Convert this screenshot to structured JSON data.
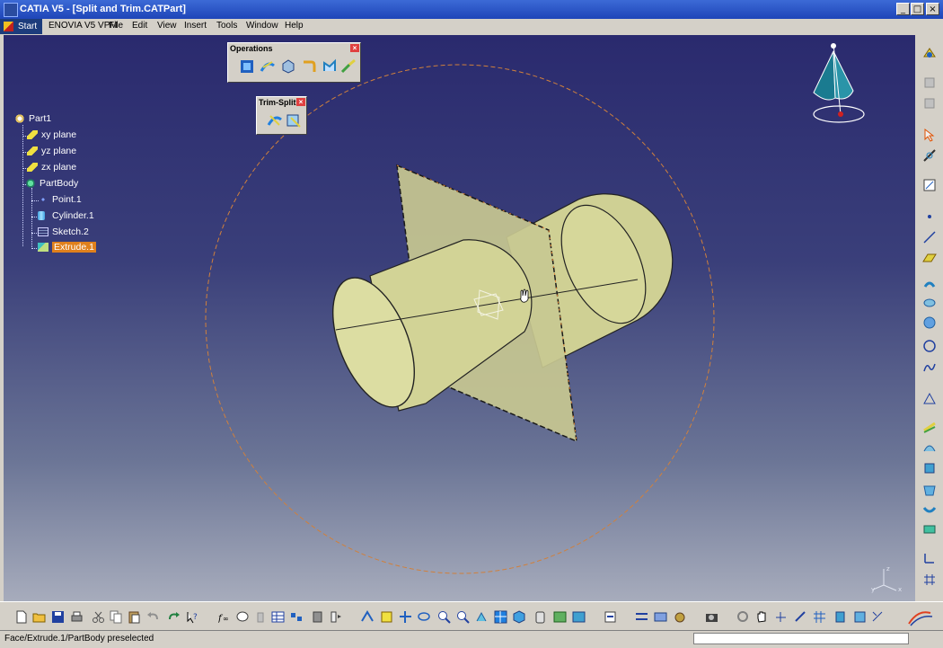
{
  "window": {
    "title": "CATIA V5 - [Split and Trim.CATPart]",
    "minimize": "_",
    "maximize": "□",
    "close": "×"
  },
  "menu": {
    "start": "Start",
    "items": [
      "ENOVIA V5 VPM",
      "File",
      "Edit",
      "View",
      "Insert",
      "Tools",
      "Window",
      "Help"
    ]
  },
  "tree": {
    "items": [
      {
        "label": "Part1",
        "icon": "part-icon"
      },
      {
        "label": "xy plane",
        "icon": "plane-icon"
      },
      {
        "label": "yz plane",
        "icon": "plane-icon"
      },
      {
        "label": "zx plane",
        "icon": "plane-icon"
      },
      {
        "label": "PartBody",
        "icon": "body-icon"
      },
      {
        "label": "Point.1",
        "icon": "point-icon"
      },
      {
        "label": "Cylinder.1",
        "icon": "cylinder-icon"
      },
      {
        "label": "Sketch.2",
        "icon": "sketch-icon"
      },
      {
        "label": "Extrude.1",
        "icon": "extrude-icon",
        "selected": true
      }
    ]
  },
  "toolbars": {
    "operations": {
      "title": "Operations",
      "close": "×"
    },
    "trim_split": {
      "title": "Trim-Split",
      "close": "×"
    }
  },
  "axis_labels": {
    "x": "x",
    "y": "y",
    "z": "z"
  },
  "status": {
    "text": "Face/Extrude.1/PartBody preselected"
  },
  "colors": {
    "selected_highlight": "#e0801c",
    "surface": "#d8d8a0",
    "background_top": "#2a2a6e",
    "background_bottom": "#a7acbc"
  }
}
